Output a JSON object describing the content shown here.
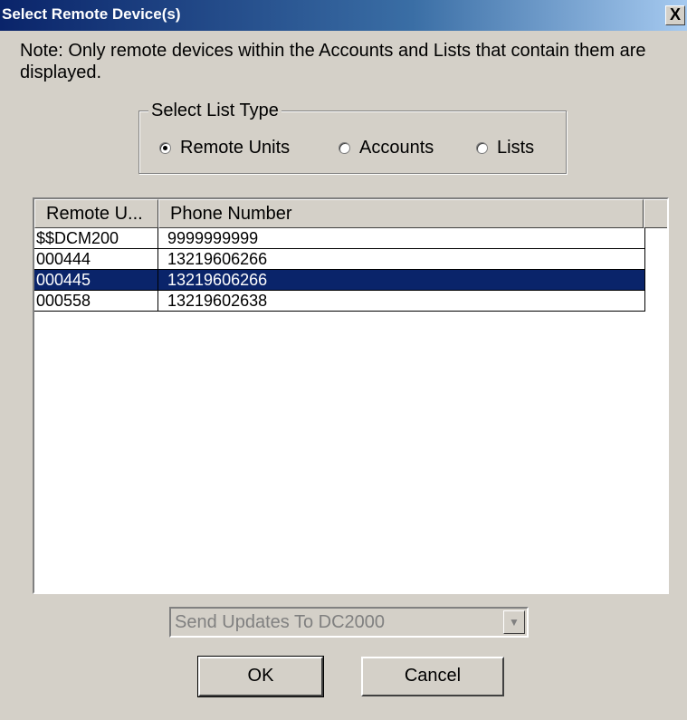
{
  "window": {
    "title": "Select Remote Device(s)",
    "close_glyph": "X"
  },
  "note": "Note: Only remote devices within the Accounts and Lists that contain them are displayed.",
  "list_type": {
    "legend": "Select List Type",
    "options": [
      {
        "label": "Remote Units",
        "checked": true
      },
      {
        "label": "Accounts",
        "checked": false
      },
      {
        "label": "Lists",
        "checked": false
      }
    ],
    "selected": "Remote Units"
  },
  "table": {
    "columns": [
      "Remote U...",
      "Phone Number"
    ],
    "rows": [
      {
        "unit": "$$DCM200",
        "phone": "9999999999",
        "selected": false
      },
      {
        "unit": "000444",
        "phone": "13219606266",
        "selected": false
      },
      {
        "unit": "000445",
        "phone": "13219606266",
        "selected": true
      },
      {
        "unit": "000558",
        "phone": "13219602638",
        "selected": false
      }
    ],
    "selection_color": "#0a246a"
  },
  "combo": {
    "value": "Send Updates To DC2000",
    "disabled": true
  },
  "buttons": {
    "ok": "OK",
    "cancel": "Cancel"
  },
  "colors": {
    "dialog_bg": "#d4d0c8",
    "titlebar_start": "#0a246a",
    "titlebar_end": "#a6caf0"
  }
}
